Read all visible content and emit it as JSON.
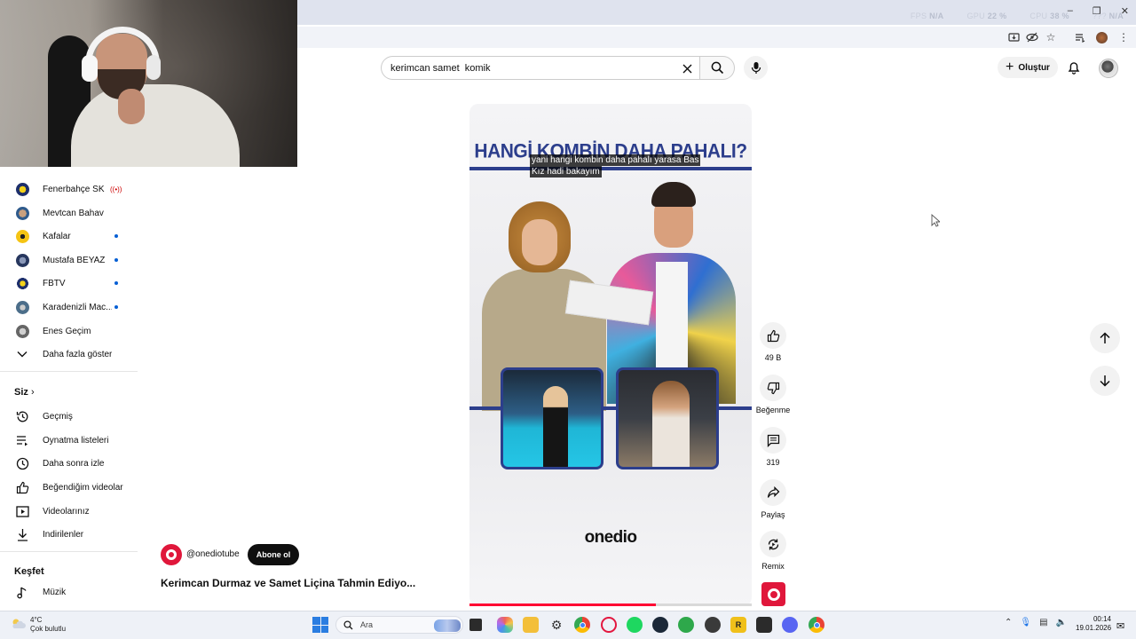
{
  "perf": {
    "fps_label": "FPS",
    "fps_value": "N/A",
    "gpu_label": "GPU",
    "gpu_value": "22 %",
    "cpu_label": "CPU",
    "cpu_value": "38 %",
    "extra_label": "???",
    "extra_value": "N/A"
  },
  "search": {
    "query": "kerimcan samet  komik"
  },
  "header": {
    "create_label": "Oluştur"
  },
  "sidebar": {
    "subscriptions": [
      {
        "label": "Fenerbahçe SK",
        "marker": "live"
      },
      {
        "label": "Mevtcan Bahav",
        "marker": "none"
      },
      {
        "label": "Kafalar",
        "marker": "dot"
      },
      {
        "label": "Mustafa BEYAZ",
        "marker": "dot"
      },
      {
        "label": "FBTV",
        "marker": "dot"
      },
      {
        "label": "Karadenizli Mac...",
        "marker": "dot"
      },
      {
        "label": "Enes Geçim",
        "marker": "none"
      }
    ],
    "show_more": "Daha fazla göster",
    "you_heading": "Siz",
    "you_items": [
      "Geçmiş",
      "Oynatma listeleri",
      "Daha sonra izle",
      "Beğendiğim videolar",
      "Videolarınız",
      "İndirilenler"
    ],
    "explore_heading": "Keşfet",
    "explore_items": [
      "Müzik"
    ]
  },
  "video": {
    "title_overlay": "HANGİ KOMBİN DAHA PAHALI?",
    "caption_line1": "yani hangi kombin daha pahalı yarasa Bas",
    "caption_line2": "Kız hadi bakayım",
    "brand": "onedio",
    "progress": 0.66
  },
  "actions": {
    "like_count": "49 B",
    "dislike_label": "Beğenme",
    "comment_count": "319",
    "share_label": "Paylaş",
    "remix_label": "Remix"
  },
  "channel": {
    "handle": "@onediotube",
    "subscribe_label": "Abone ol",
    "video_title": "Kerimcan Durmaz ve Samet Liçina Tahmin Ediyo..."
  },
  "taskbar": {
    "weather_temp": "4°C",
    "weather_desc": "Çok bulutlu",
    "search_placeholder": "Ara",
    "time": "00:14",
    "date": "19.01.2026"
  },
  "colors": {
    "accent_blue": "#065fd4",
    "brand_red": "#e0173b",
    "progress_red": "#ff0033",
    "overlay_navy": "#2c3e8c"
  }
}
